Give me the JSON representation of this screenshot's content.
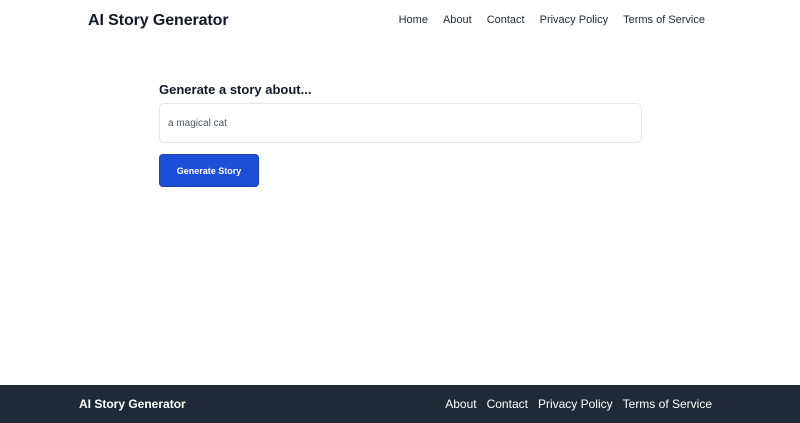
{
  "header": {
    "brand": "AI Story Generator",
    "nav": [
      "Home",
      "About",
      "Contact",
      "Privacy Policy",
      "Terms of Service"
    ]
  },
  "form": {
    "label": "Generate a story about...",
    "input_placeholder": "a magical cat",
    "input_value": "",
    "button_label": "Generate Story"
  },
  "footer": {
    "brand": "AI Story Generator",
    "links": [
      "About",
      "Contact",
      "Privacy Policy",
      "Terms of Service"
    ]
  },
  "colors": {
    "primary_button": "#1d4ed8",
    "footer_background": "#1f2937",
    "page_background": "#ffffff"
  }
}
